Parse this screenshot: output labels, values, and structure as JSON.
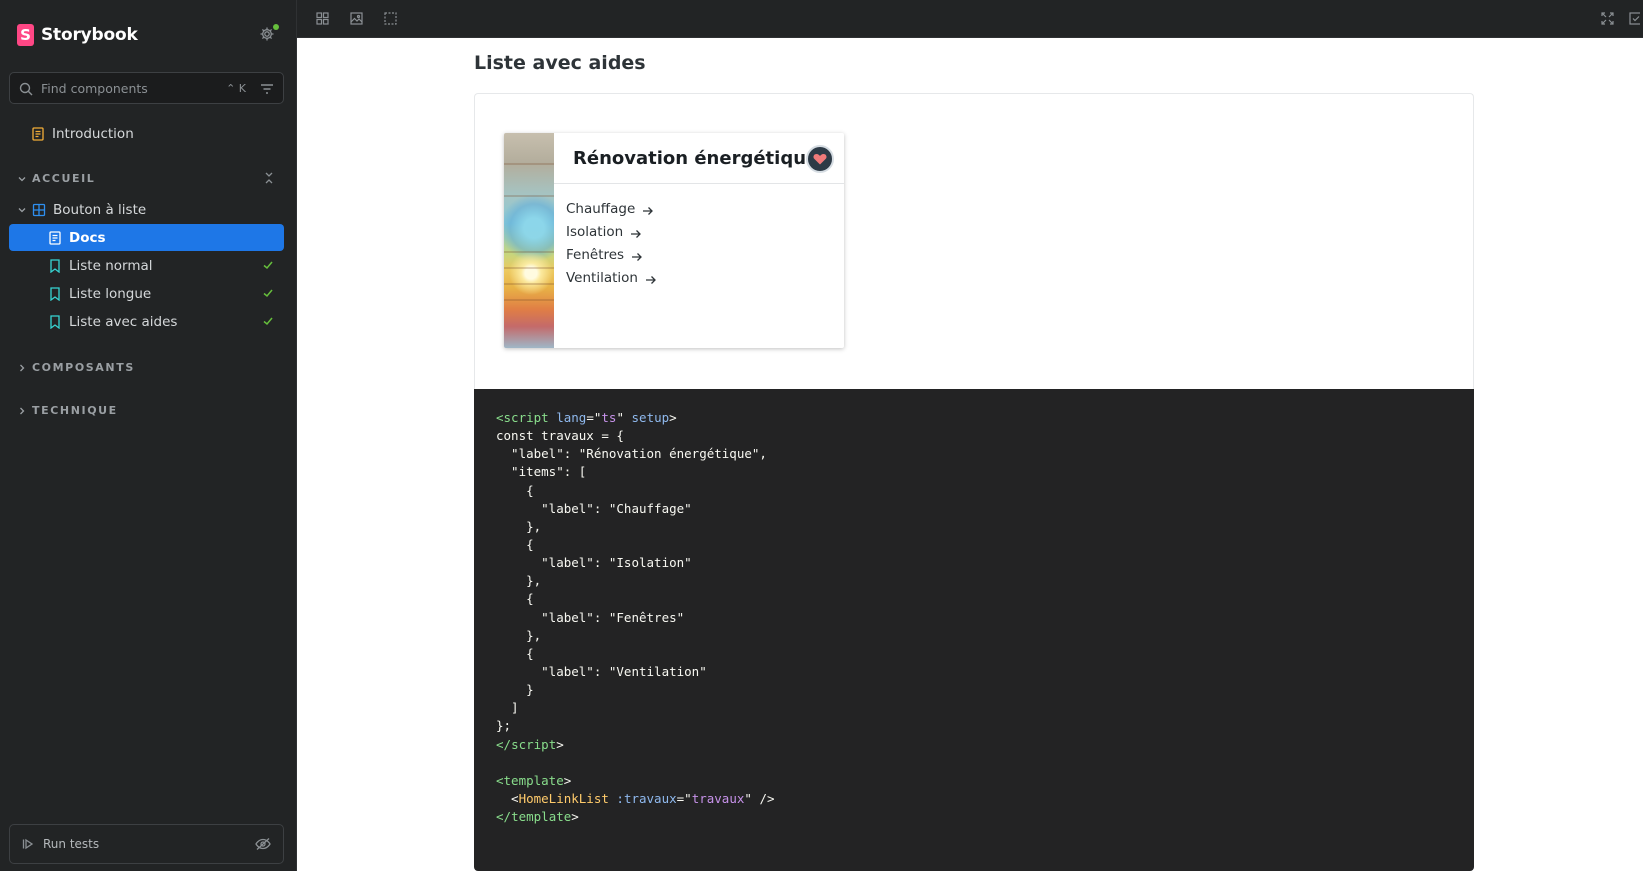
{
  "sidebar": {
    "brand": {
      "logo_letter": "S",
      "name": "Storybook"
    },
    "search": {
      "placeholder": "Find components",
      "shortcut": "⌃ K"
    },
    "introduction": "Introduction",
    "sections": [
      {
        "label": "ACCUEIL",
        "expanded": true
      },
      {
        "label": "COMPOSANTS",
        "expanded": false
      },
      {
        "label": "TECHNIQUE",
        "expanded": false
      }
    ],
    "component": "Bouton à liste",
    "stories": [
      {
        "label": "Docs",
        "active": true,
        "status": ""
      },
      {
        "label": "Liste normal",
        "active": false,
        "status": "pass"
      },
      {
        "label": "Liste longue",
        "active": false,
        "status": "pass"
      },
      {
        "label": "Liste avec aides",
        "active": false,
        "status": "pass"
      }
    ],
    "run_tests": "Run tests",
    "accent_color": "#1e77e7",
    "status_color": "#66bf3c"
  },
  "toolbar": {
    "tools": [
      "grid-icon",
      "background-icon",
      "outline-icon"
    ],
    "right_tools": [
      "fullscreen-icon",
      "share-icon"
    ]
  },
  "docs": {
    "title": "Liste avec aides",
    "card": {
      "title": "Rénovation énergétique",
      "badge_icon": "heart-house-icon",
      "items": [
        "Chauffage",
        "Isolation",
        "Fenêtres",
        "Ventilation"
      ]
    },
    "code": [
      [
        [
          "tag",
          "<"
        ],
        [
          "tag",
          "script"
        ],
        [
          "plain",
          " "
        ],
        [
          "attr",
          "lang"
        ],
        [
          "plain",
          "=\""
        ],
        [
          "str",
          "ts"
        ],
        [
          "plain",
          "\" "
        ],
        [
          "attr",
          "setup"
        ],
        [
          "plain",
          ">"
        ]
      ],
      [
        [
          "plain",
          "const travaux = {"
        ]
      ],
      [
        [
          "plain",
          "  \"label\": \"Rénovation énergétique\","
        ]
      ],
      [
        [
          "plain",
          "  \"items\": ["
        ]
      ],
      [
        [
          "plain",
          "    {"
        ]
      ],
      [
        [
          "plain",
          "      \"label\": \"Chauffage\""
        ]
      ],
      [
        [
          "plain",
          "    },"
        ]
      ],
      [
        [
          "plain",
          "    {"
        ]
      ],
      [
        [
          "plain",
          "      \"label\": \"Isolation\""
        ]
      ],
      [
        [
          "plain",
          "    },"
        ]
      ],
      [
        [
          "plain",
          "    {"
        ]
      ],
      [
        [
          "plain",
          "      \"label\": \"Fenêtres\""
        ]
      ],
      [
        [
          "plain",
          "    },"
        ]
      ],
      [
        [
          "plain",
          "    {"
        ]
      ],
      [
        [
          "plain",
          "      \"label\": \"Ventilation\""
        ]
      ],
      [
        [
          "plain",
          "    }"
        ]
      ],
      [
        [
          "plain",
          "  ]"
        ]
      ],
      [
        [
          "plain",
          "};"
        ]
      ],
      [
        [
          "tag",
          "</"
        ],
        [
          "tag",
          "script"
        ],
        [
          "plain",
          ">"
        ]
      ],
      [
        [
          "plain",
          ""
        ]
      ],
      [
        [
          "tag",
          "<"
        ],
        [
          "tag",
          "template"
        ],
        [
          "plain",
          ">"
        ]
      ],
      [
        [
          "plain",
          "  <"
        ],
        [
          "comp",
          "HomeLinkList"
        ],
        [
          "plain",
          " "
        ],
        [
          "attr",
          ":travaux"
        ],
        [
          "plain",
          "=\""
        ],
        [
          "str",
          "travaux"
        ],
        [
          "plain",
          "\" />"
        ]
      ],
      [
        [
          "tag",
          "</"
        ],
        [
          "tag",
          "template"
        ],
        [
          "plain",
          ">"
        ]
      ]
    ]
  }
}
